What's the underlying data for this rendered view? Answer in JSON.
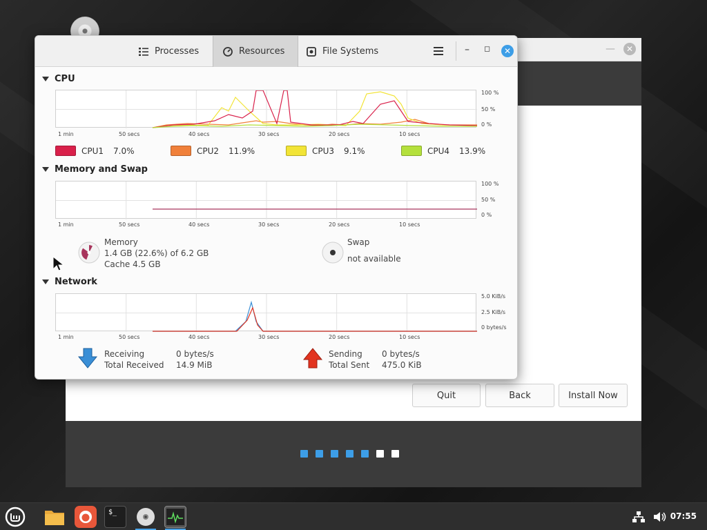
{
  "colors": {
    "cpu1": "#d9204a",
    "cpu2": "#f0803a",
    "cpu3": "#f2e436",
    "cpu4": "#b4e03c",
    "accent": "#3d9ee7"
  },
  "sysmon": {
    "tabs": [
      {
        "label": "Processes",
        "icon": "list-icon",
        "active": false
      },
      {
        "label": "Resources",
        "icon": "gauge-icon",
        "active": true
      },
      {
        "label": "File Systems",
        "icon": "disk-icon",
        "active": false
      }
    ],
    "menu_icon": "hamburger-icon",
    "cpu": {
      "title": "CPU",
      "legend": [
        {
          "name": "CPU1",
          "value": "7.0%"
        },
        {
          "name": "CPU2",
          "value": "11.9%"
        },
        {
          "name": "CPU3",
          "value": "9.1%"
        },
        {
          "name": "CPU4",
          "value": "13.9%"
        }
      ],
      "yticks": [
        "100 %",
        "50 %",
        "0 %"
      ]
    },
    "memory": {
      "title": "Memory and Swap",
      "yticks": [
        "100 %",
        "50 %",
        "0 %"
      ],
      "memory_label": "Memory",
      "memory_usage": "1.4 GB (22.6%) of 6.2 GB",
      "memory_cache": "Cache 4.5 GB",
      "swap_label": "Swap",
      "swap_status": "not available"
    },
    "network": {
      "title": "Network",
      "yticks": [
        "5.0 KiB/s",
        "2.5 KiB/s",
        "0 bytes/s"
      ],
      "receiving_label": "Receiving",
      "receiving_value": "0 bytes/s",
      "total_received_label": "Total Received",
      "total_received_value": "14.9 MiB",
      "sending_label": "Sending",
      "sending_value": "0 bytes/s",
      "total_sent_label": "Total Sent",
      "total_sent_value": "475.0 KiB"
    },
    "xticks": [
      "1 min",
      "50 secs",
      "40 secs",
      "30 secs",
      "20 secs",
      "10 secs"
    ]
  },
  "installer": {
    "buttons": {
      "quit": "Quit",
      "back": "Back",
      "install": "Install Now"
    },
    "progress": {
      "total": 7,
      "completed": 5
    }
  },
  "taskbar": {
    "clock": "07:55",
    "apps": [
      "mint-menu-icon",
      "files-icon",
      "firefox-icon",
      "terminal-icon",
      "disc-icon",
      "system-monitor-icon"
    ]
  }
}
